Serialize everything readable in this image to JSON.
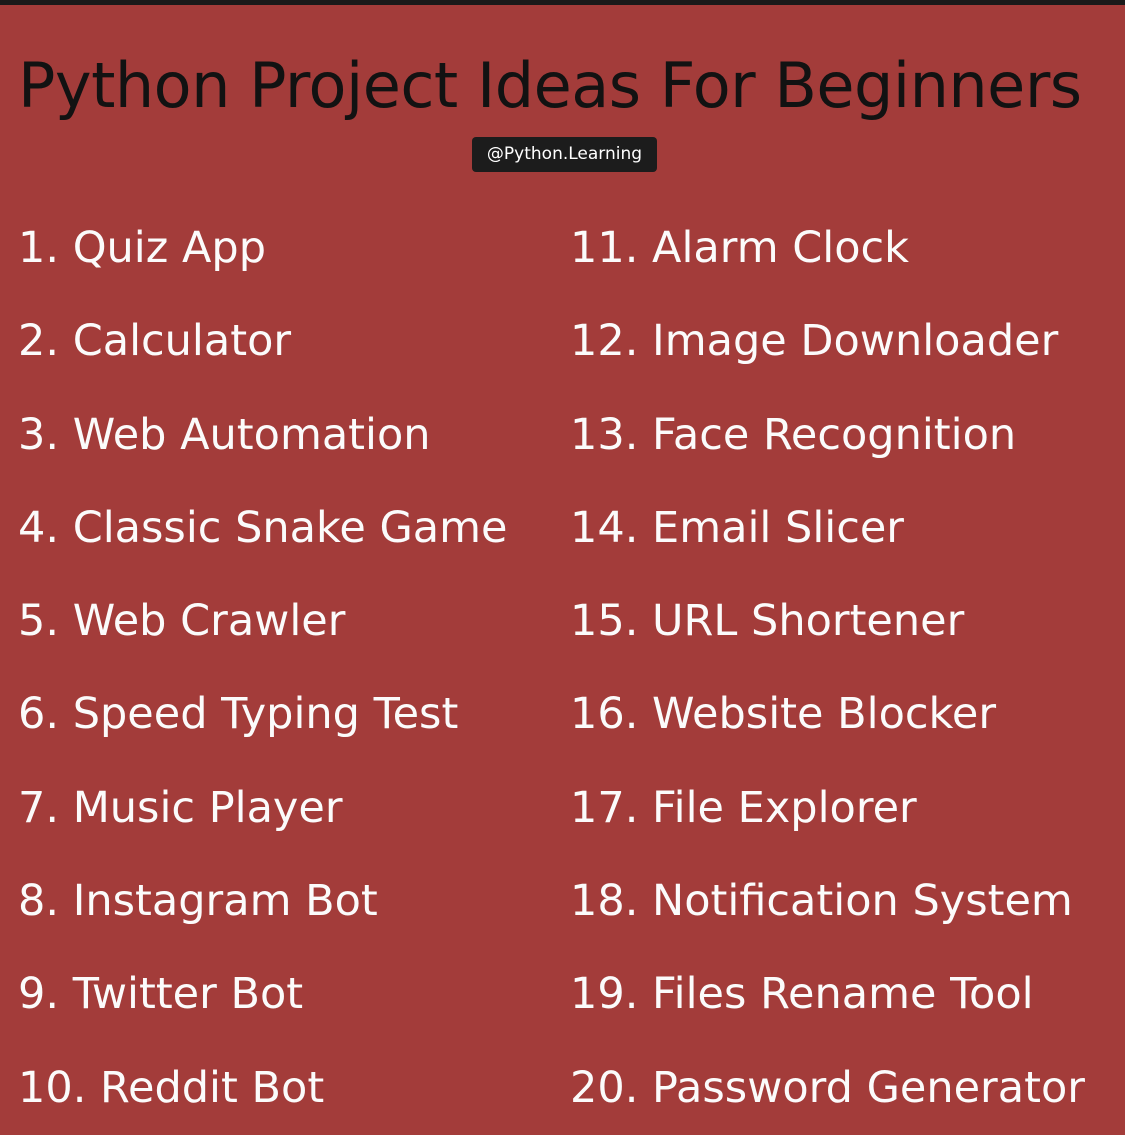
{
  "title": "Python Project Ideas For Beginners",
  "handle": "@Python.Learning",
  "colors": {
    "background": "#a33c3a",
    "title": "#121212",
    "badge_background": "#1c1c1c",
    "item_text": "#fbfbfb"
  },
  "ideas_left": [
    "1. Quiz App",
    "2. Calculator",
    "3. Web Automation",
    "4. Classic Snake Game",
    "5. Web Crawler",
    "6. Speed Typing Test",
    "7. Music Player",
    "8. Instagram Bot",
    "9. Twitter Bot",
    "10. Reddit Bot"
  ],
  "ideas_right": [
    "11. Alarm Clock",
    "12. Image Downloader",
    "13. Face Recognition",
    "14. Email Slicer",
    "15. URL Shortener",
    "16. Website Blocker",
    "17. File Explorer",
    "18. Notification System",
    "19. Files Rename Tool",
    "20. Password Generator"
  ]
}
